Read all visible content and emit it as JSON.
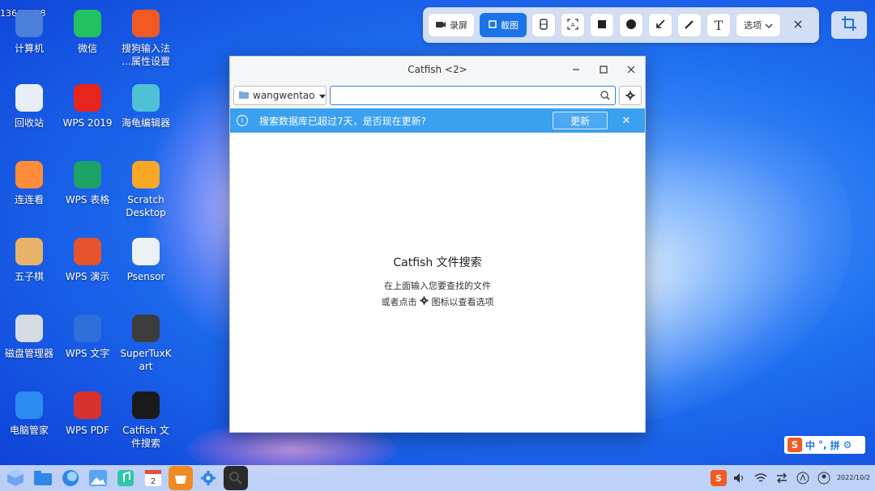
{
  "screen": {
    "resolution_label": "1366X768"
  },
  "desktop_icons": [
    {
      "label": "计算机",
      "icon": "computer-icon",
      "color": "#4b7fd9"
    },
    {
      "label": "微信",
      "icon": "wechat-icon",
      "color": "#22c35e"
    },
    {
      "label": "搜狗输入法\n…属性设置",
      "icon": "sogou-icon",
      "color": "#f25a22"
    },
    {
      "label": "回收站",
      "icon": "trash-icon",
      "color": "#e9eef6"
    },
    {
      "label": "WPS 2019",
      "icon": "wps-icon",
      "color": "#e8241d"
    },
    {
      "label": "海龟编辑器",
      "icon": "turtle-icon",
      "color": "#4fc1d4"
    },
    {
      "label": "连连看",
      "icon": "lianliankan-icon",
      "color": "#ff8c3a"
    },
    {
      "label": "WPS 表格",
      "icon": "wps-sheet-icon",
      "color": "#1da366"
    },
    {
      "label": "Scratch\nDesktop",
      "icon": "scratch-icon",
      "color": "#f9a825"
    },
    {
      "label": "五子棋",
      "icon": "gomoku-icon",
      "color": "#e7b36a"
    },
    {
      "label": "WPS 演示",
      "icon": "wps-slides-icon",
      "color": "#e5542c"
    },
    {
      "label": "Psensor",
      "icon": "psensor-icon",
      "color": "#ecf0f5"
    },
    {
      "label": "磁盘管理器",
      "icon": "disk-icon",
      "color": "#d5dbe3"
    },
    {
      "label": "WPS 文字",
      "icon": "wps-writer-icon",
      "color": "#2f6fd9"
    },
    {
      "label": "SuperTuxK\nart",
      "icon": "supertuxkart-icon",
      "color": "#3d3d3d"
    },
    {
      "label": "电脑管家",
      "icon": "pc-manager-icon",
      "color": "#2a8cf0"
    },
    {
      "label": "WPS PDF",
      "icon": "wps-pdf-icon",
      "color": "#d8322f"
    },
    {
      "label": "Catfish 文\n件搜索",
      "icon": "catfish-icon",
      "color": "#1a1a1a"
    }
  ],
  "screenshot_toolbar": {
    "record_label": "录屏",
    "capture_label": "截图",
    "options_label": "选项",
    "text_tool_label": "T"
  },
  "window": {
    "title": "Catfish <2>",
    "location": "wangwentao",
    "search_value": "",
    "info_message": "搜索数据库已超过7天，是否现在更新?",
    "update_label": "更新",
    "empty_title": "Catfish 文件搜索",
    "empty_line1": "在上面输入您要查找的文件",
    "empty_line2_prefix": "或者点击",
    "empty_line2_suffix": "图标以查看选项"
  },
  "ime": {
    "chinese": "中",
    "pinyin": "拼"
  },
  "clock": {
    "date": "2022/10/2"
  }
}
